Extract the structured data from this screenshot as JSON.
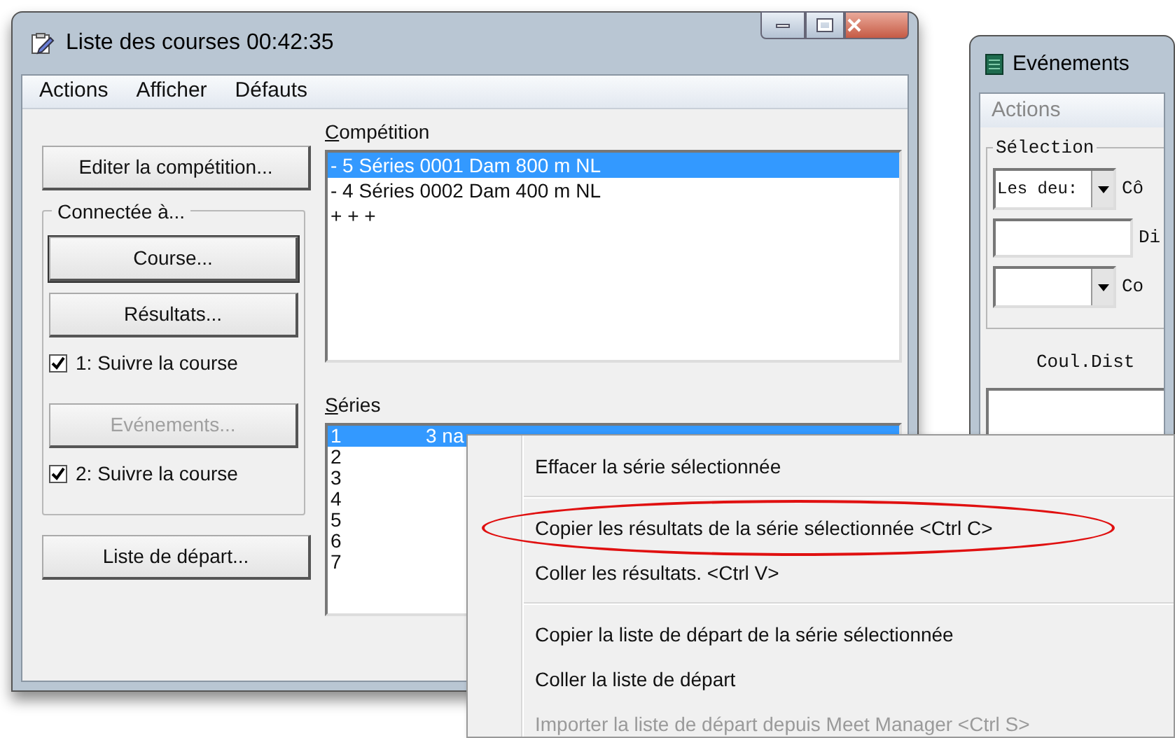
{
  "main_window": {
    "title": "Liste des courses  00:42:35",
    "menu": [
      "Actions",
      "Afficher",
      "Défauts"
    ],
    "edit_button": "Editer la compétition...",
    "group": {
      "label": "Connectée à...",
      "items": [
        {
          "kind": "button",
          "label": "Course...",
          "disabled": false,
          "focused": true
        },
        {
          "kind": "button",
          "label": "Résultats...",
          "disabled": false,
          "focused": false
        },
        {
          "kind": "checkbox",
          "label": "1: Suivre la course",
          "checked": true
        },
        {
          "kind": "button",
          "label": "Evénements...",
          "disabled": true,
          "focused": false
        },
        {
          "kind": "checkbox",
          "label": "2: Suivre la course",
          "checked": true
        }
      ]
    },
    "start_list_button": "Liste de départ...",
    "competition": {
      "label": "Compétition",
      "rows": [
        {
          "text": "- 5 Séries 0001 Dam 800 m NL",
          "selected": true
        },
        {
          "text": "- 4 Séries 0002 Dam 400 m NL",
          "selected": false
        },
        {
          "text": "+ + +",
          "selected": false
        }
      ]
    },
    "series": {
      "label": "Séries",
      "rows": [
        {
          "number": "1",
          "column_2": "3 na",
          "selected": true
        },
        {
          "number": "2",
          "selected": false
        },
        {
          "number": "3",
          "selected": false
        },
        {
          "number": "4",
          "selected": false
        },
        {
          "number": "5",
          "selected": false
        },
        {
          "number": "6",
          "selected": false
        },
        {
          "number": "7",
          "selected": false
        }
      ]
    }
  },
  "events_window": {
    "title": "Evénements",
    "menu": [
      "Actions"
    ],
    "group_label": "Sélection",
    "fields": [
      {
        "kind": "combo",
        "value": "Les deu:",
        "label": "Cô"
      },
      {
        "kind": "input",
        "label": "Di"
      },
      {
        "kind": "combo",
        "label": "Co"
      }
    ],
    "column_header": "Coul.Dist"
  },
  "context_menu": [
    {
      "label": "Effacer la série sélectionnée",
      "disabled": false,
      "highlighted": false
    },
    {
      "kind": "separator"
    },
    {
      "label": "Copier les résultats de la série sélectionnée  <Ctrl C>",
      "disabled": false,
      "highlighted": true
    },
    {
      "label": "Coller les résultats.  <Ctrl V>",
      "disabled": false,
      "highlighted": false
    },
    {
      "kind": "separator"
    },
    {
      "label": "Copier la liste de départ de la série sélectionnée",
      "disabled": false,
      "highlighted": false
    },
    {
      "label": "Coller la liste de départ",
      "disabled": false,
      "highlighted": false
    },
    {
      "label": "Importer la liste de départ depuis Meet Manager  <Ctrl S>",
      "disabled": true,
      "highlighted": false
    }
  ]
}
